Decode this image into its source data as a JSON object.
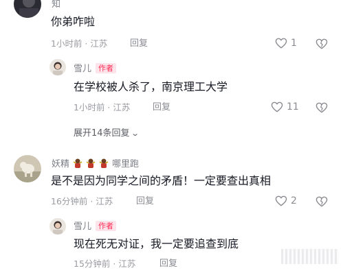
{
  "comments": [
    {
      "username": "知",
      "text": "你弟咋啦",
      "time": "1小时前",
      "location": "江苏",
      "reply_label": "回复",
      "likes": "1"
    },
    {
      "username": "雪儿",
      "author_badge": "作者",
      "text": "在学校被人杀了，南京理工大学",
      "time": "1小时前",
      "location": "江苏",
      "reply_label": "回复",
      "likes": "11"
    },
    {
      "expand_label": "展开14条回复"
    },
    {
      "username_prefix": "妖精",
      "username_suffix": "哪里跑",
      "text": "是不是因为同学之间的矛盾！一定要查出真相",
      "time": "16分钟前",
      "location": "江苏",
      "reply_label": "回复",
      "likes": "2"
    },
    {
      "username": "雪儿",
      "author_badge": "作者",
      "text": "现在死无对证，我一定要追查到底",
      "time": "15分钟前",
      "location": "江苏",
      "reply_label": "回复"
    }
  ],
  "meta_separator": " · ",
  "icons": {
    "like": "heart-outline-icon",
    "dislike": "broken-heart-icon",
    "expand": "chevron-down-icon",
    "emoji": "doll-emoji-icon"
  },
  "colors": {
    "author_badge_text": "#fe2c55",
    "author_badge_bg": "#fde4ea",
    "text": "#161823",
    "meta": "#9a9ba1"
  }
}
